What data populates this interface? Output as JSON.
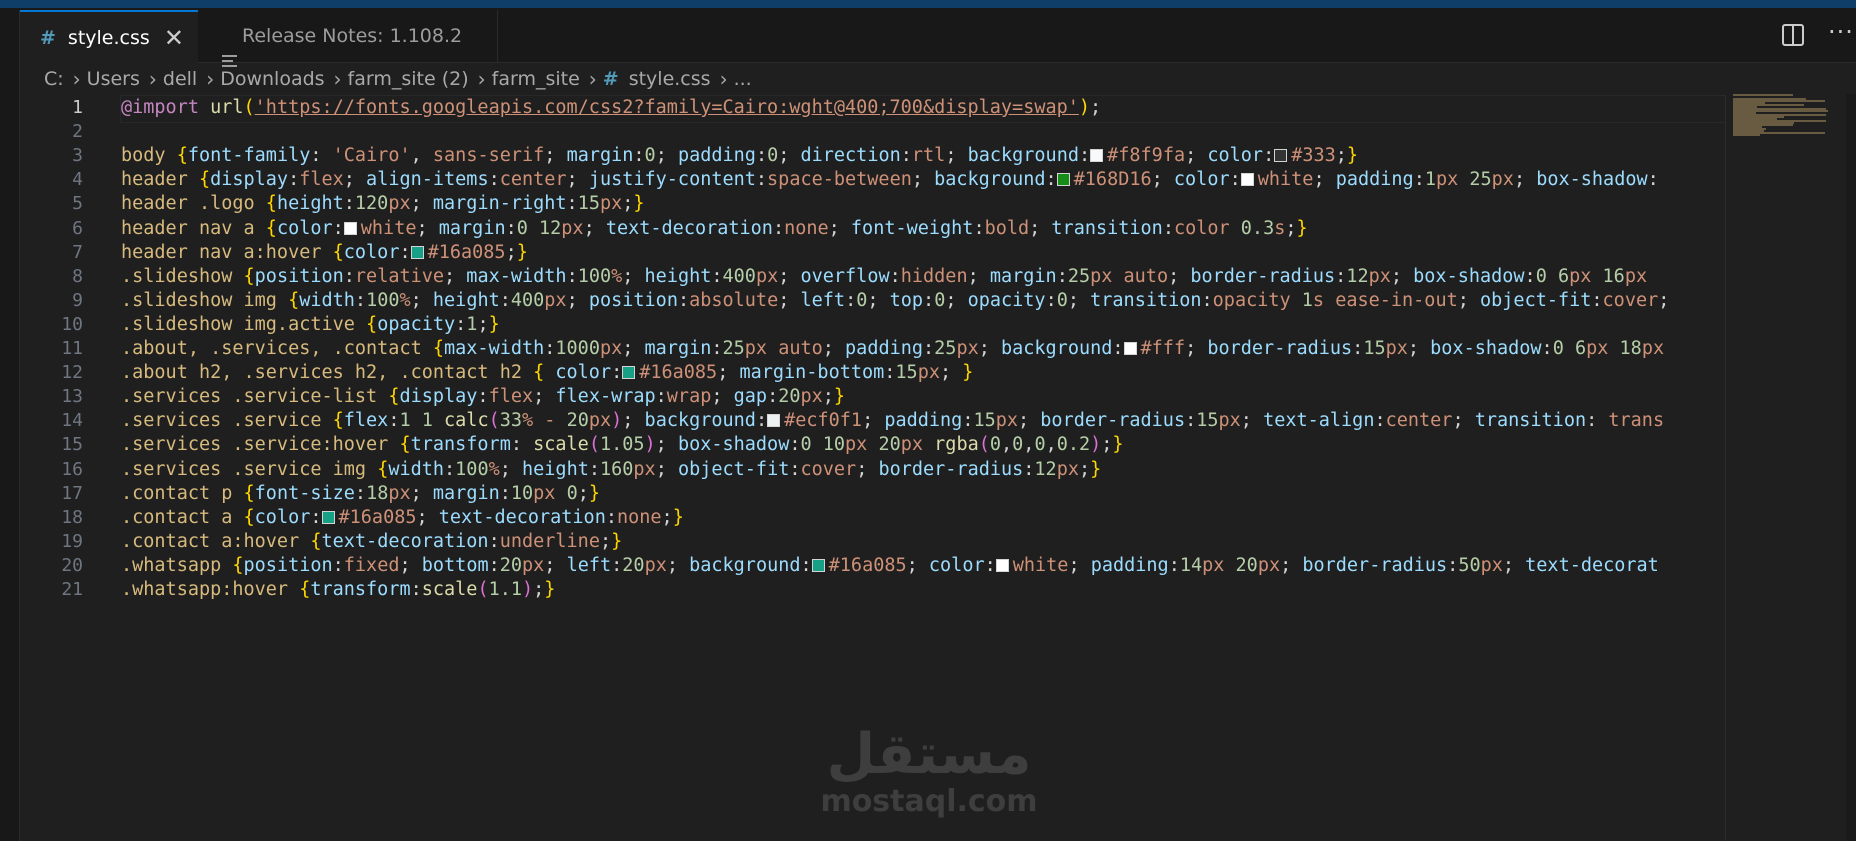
{
  "tabs": [
    {
      "label": "style.css",
      "icon": "css-hash-icon",
      "active": true,
      "close": "✕"
    },
    {
      "label": "Release Notes: 1.108.2",
      "icon": "preview-icon",
      "active": false
    }
  ],
  "breadcrumb": {
    "items": [
      "C:",
      "Users",
      "dell",
      "Downloads",
      "farm_site (2)",
      "farm_site",
      "style.css",
      "..."
    ],
    "separator": "›",
    "file_icon": "#"
  },
  "editor": {
    "current_line": 1,
    "line_numbers": [
      "1",
      "2",
      "3",
      "4",
      "5",
      "6",
      "7",
      "8",
      "9",
      "10",
      "11",
      "12",
      "13",
      "14",
      "15",
      "16",
      "17",
      "18",
      "19",
      "20",
      "21"
    ],
    "lines": [
      "@import url('https://fonts.googleapis.com/css2?family=Cairo:wght@400;700&display=swap');",
      "",
      "body {font-family: 'Cairo', sans-serif; margin:0; padding:0; direction:rtl; background:#f8f9fa; color:#333;}",
      "header {display:flex; align-items:center; justify-content:space-between; background:#168D16; color:white; padding:1px 25px; box-shadow:",
      "header .logo {height:120px; margin-right:15px;}",
      "header nav a {color:white; margin:0 12px; text-decoration:none; font-weight:bold; transition:color 0.3s;}",
      "header nav a:hover {color:#16a085;}",
      ".slideshow {position:relative; max-width:100%; height:400px; overflow:hidden; margin:25px auto; border-radius:12px; box-shadow:0 6px 16px",
      ".slideshow img {width:100%; height:400px; position:absolute; left:0; top:0; opacity:0; transition:opacity 1s ease-in-out; object-fit:cover;",
      ".slideshow img.active {opacity:1;}",
      ".about, .services, .contact {max-width:1000px; margin:25px auto; padding:25px; background:#fff; border-radius:15px; box-shadow:0 6px 18px",
      ".about h2, .services h2, .contact h2 { color:#16a085; margin-bottom:15px; }",
      ".services .service-list {display:flex; flex-wrap:wrap; gap:20px;}",
      ".services .service {flex:1 1 calc(33% - 20px); background:#ecf0f1; padding:15px; border-radius:15px; text-align:center; transition: trans",
      ".services .service:hover {transform: scale(1.05); box-shadow:0 10px 20px rgba(0,0,0,0.2);}",
      ".services .service img {width:100%; height:160px; object-fit:cover; border-radius:12px;}",
      ".contact p {font-size:18px; margin:10px 0;}",
      ".contact a {color:#16a085; text-decoration:none;}",
      ".contact a:hover {text-decoration:underline;}",
      ".whatsapp {position:fixed; bottom:20px; left:20px; background:#16a085; color:white; padding:14px 20px; border-radius:50px; text-decorat",
      ".whatsapp:hover {transform:scale(1.1);}"
    ]
  },
  "colors": {
    "syntax_selector": "#d7ba7d",
    "syntax_property": "#9cdcfe",
    "syntax_value": "#ce9178",
    "syntax_number": "#b5cea8",
    "syntax_keyword": "#c586c0",
    "syntax_function": "#dcdcaa",
    "swatch_white": "#ffffff",
    "swatch_green": "#168D16",
    "swatch_teal": "#16a085",
    "swatch_dark": "#333333",
    "tab_accent": "#0078d4"
  },
  "toolbar": {
    "split_icon": "split-editor-icon",
    "more_label": "···"
  },
  "watermark": {
    "arabic": "مستقل",
    "latin": "mostaql.com"
  }
}
